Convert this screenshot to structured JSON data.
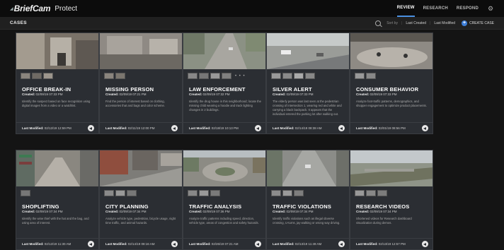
{
  "header": {
    "logo": "BriefCam",
    "product": "Protect",
    "tabs": [
      "REVIEW",
      "RESEARCH",
      "RESPOND"
    ],
    "active_tab": "REVIEW"
  },
  "subheader": {
    "title": "CASES",
    "sort_label": "Sort by",
    "sort_options": [
      "Last Created",
      "Last Modified"
    ],
    "create_label": "CREATE CASE"
  },
  "labels": {
    "created": "Created:",
    "modified": "Last Modified:"
  },
  "cards": [
    {
      "title": "OFFICE BREAK-IN",
      "created": "02/09/19 07:33 PM",
      "desc": "Identify the suspect based on face recognition using digital images from a video or a watchlist.",
      "modified": "02/12/19 12:59 PM",
      "more": ""
    },
    {
      "title": "MISSING PERSON",
      "created": "02/09/19 07:21 PM",
      "desc": "Find the person of interest based on clothing, accessories that and bags and color scheme.",
      "modified": "02/11/19 12:00 PM",
      "more": ""
    },
    {
      "title": "LAW ENFORCEMENT",
      "created": "02/09/19 07:32 PM",
      "desc": "Identify the drug house in this neighborhood; locate the missing child wearing a hoodie and track lighting changes in 2 buildings.",
      "modified": "02/18/19 10:13 PM",
      "more": "• • •"
    },
    {
      "title": "SILVER ALERT",
      "created": "02/09/19 07:33 PM",
      "desc": "The elderly person was last seen at the pedestrian crossing of intersection 1, wearing red and white and carrying a black backpack. It appears that the individual entered the parking lot after walking out.",
      "modified": "02/14/19 08:38 AM",
      "more": ""
    },
    {
      "title": "CONSUMER BEHAVIOR",
      "created": "02/09/19 07:33 PM",
      "desc": "Analyze foot-traffic patterns, demographics, and shopper engagement to optimize product placements.",
      "modified": "02/01/19 08:56 PM",
      "more": ""
    },
    {
      "title": "SHOPLIFTING",
      "created": "02/09/19 07:34 PM",
      "desc": "Identify the wine thief with the hat and the bag, and using area of interest.",
      "modified": "02/12/19 11:30 AM",
      "more": ""
    },
    {
      "title": "CITY PLANNING",
      "created": "02/09/19 07:34 PM",
      "desc": "Analyze vehicle type, pedestrian, bicycle usage, night time traffic, and animal hazards.",
      "modified": "02/14/19 08:16 AM",
      "more": ""
    },
    {
      "title": "TRAFFIC ANALYSIS",
      "created": "02/09/19 07:36 PM",
      "desc": "Analyze traffic patterns including speed, direction, vehicle type, areas of congestion and safety hazards.",
      "modified": "02/26/19 07:21 AM",
      "more": ""
    },
    {
      "title": "TRAFFIC VIOLATIONS",
      "created": "02/09/19 07:34 PM",
      "desc": "Identify traffic violations such as illegal obverse crossing, U-turns, jay-walking or wrong way driving.",
      "modified": "02/13/19 11:49 AM",
      "more": ""
    },
    {
      "title": "RESEARCH VIDEOS",
      "created": "02/09/19 07:34 PM",
      "desc": "Shortened videos for Research dashboard visualization during demos.",
      "modified": "02/13/19 12:57 PM",
      "more": ""
    }
  ]
}
